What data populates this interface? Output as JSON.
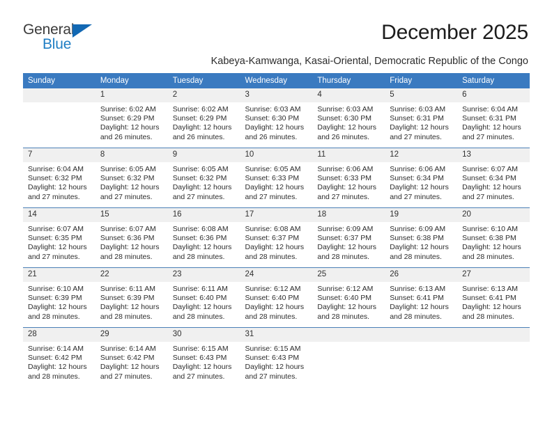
{
  "brand": {
    "name_top": "General",
    "name_bottom": "Blue",
    "triangle_color": "#1268b3",
    "blue_color": "#1f7ec4",
    "gray_color": "#3b3b3b"
  },
  "header": {
    "month_title": "December 2025",
    "location": "Kabeya-Kamwanga, Kasai-Oriental, Democratic Republic of the Congo"
  },
  "theme": {
    "header_blue": "#3a7ac0",
    "daynum_band": "#f0f0f0",
    "grid_line": "#4a7fb5",
    "text": "#2c2c2c"
  },
  "columns": [
    "Sunday",
    "Monday",
    "Tuesday",
    "Wednesday",
    "Thursday",
    "Friday",
    "Saturday"
  ],
  "weeks": [
    [
      {
        "day": "",
        "sunrise": "",
        "sunset": "",
        "daylight_line1": "",
        "daylight_line2": ""
      },
      {
        "day": "1",
        "sunrise": "Sunrise: 6:02 AM",
        "sunset": "Sunset: 6:29 PM",
        "daylight_line1": "Daylight: 12 hours",
        "daylight_line2": "and 26 minutes."
      },
      {
        "day": "2",
        "sunrise": "Sunrise: 6:02 AM",
        "sunset": "Sunset: 6:29 PM",
        "daylight_line1": "Daylight: 12 hours",
        "daylight_line2": "and 26 minutes."
      },
      {
        "day": "3",
        "sunrise": "Sunrise: 6:03 AM",
        "sunset": "Sunset: 6:30 PM",
        "daylight_line1": "Daylight: 12 hours",
        "daylight_line2": "and 26 minutes."
      },
      {
        "day": "4",
        "sunrise": "Sunrise: 6:03 AM",
        "sunset": "Sunset: 6:30 PM",
        "daylight_line1": "Daylight: 12 hours",
        "daylight_line2": "and 26 minutes."
      },
      {
        "day": "5",
        "sunrise": "Sunrise: 6:03 AM",
        "sunset": "Sunset: 6:31 PM",
        "daylight_line1": "Daylight: 12 hours",
        "daylight_line2": "and 27 minutes."
      },
      {
        "day": "6",
        "sunrise": "Sunrise: 6:04 AM",
        "sunset": "Sunset: 6:31 PM",
        "daylight_line1": "Daylight: 12 hours",
        "daylight_line2": "and 27 minutes."
      }
    ],
    [
      {
        "day": "7",
        "sunrise": "Sunrise: 6:04 AM",
        "sunset": "Sunset: 6:32 PM",
        "daylight_line1": "Daylight: 12 hours",
        "daylight_line2": "and 27 minutes."
      },
      {
        "day": "8",
        "sunrise": "Sunrise: 6:05 AM",
        "sunset": "Sunset: 6:32 PM",
        "daylight_line1": "Daylight: 12 hours",
        "daylight_line2": "and 27 minutes."
      },
      {
        "day": "9",
        "sunrise": "Sunrise: 6:05 AM",
        "sunset": "Sunset: 6:32 PM",
        "daylight_line1": "Daylight: 12 hours",
        "daylight_line2": "and 27 minutes."
      },
      {
        "day": "10",
        "sunrise": "Sunrise: 6:05 AM",
        "sunset": "Sunset: 6:33 PM",
        "daylight_line1": "Daylight: 12 hours",
        "daylight_line2": "and 27 minutes."
      },
      {
        "day": "11",
        "sunrise": "Sunrise: 6:06 AM",
        "sunset": "Sunset: 6:33 PM",
        "daylight_line1": "Daylight: 12 hours",
        "daylight_line2": "and 27 minutes."
      },
      {
        "day": "12",
        "sunrise": "Sunrise: 6:06 AM",
        "sunset": "Sunset: 6:34 PM",
        "daylight_line1": "Daylight: 12 hours",
        "daylight_line2": "and 27 minutes."
      },
      {
        "day": "13",
        "sunrise": "Sunrise: 6:07 AM",
        "sunset": "Sunset: 6:34 PM",
        "daylight_line1": "Daylight: 12 hours",
        "daylight_line2": "and 27 minutes."
      }
    ],
    [
      {
        "day": "14",
        "sunrise": "Sunrise: 6:07 AM",
        "sunset": "Sunset: 6:35 PM",
        "daylight_line1": "Daylight: 12 hours",
        "daylight_line2": "and 27 minutes."
      },
      {
        "day": "15",
        "sunrise": "Sunrise: 6:07 AM",
        "sunset": "Sunset: 6:36 PM",
        "daylight_line1": "Daylight: 12 hours",
        "daylight_line2": "and 28 minutes."
      },
      {
        "day": "16",
        "sunrise": "Sunrise: 6:08 AM",
        "sunset": "Sunset: 6:36 PM",
        "daylight_line1": "Daylight: 12 hours",
        "daylight_line2": "and 28 minutes."
      },
      {
        "day": "17",
        "sunrise": "Sunrise: 6:08 AM",
        "sunset": "Sunset: 6:37 PM",
        "daylight_line1": "Daylight: 12 hours",
        "daylight_line2": "and 28 minutes."
      },
      {
        "day": "18",
        "sunrise": "Sunrise: 6:09 AM",
        "sunset": "Sunset: 6:37 PM",
        "daylight_line1": "Daylight: 12 hours",
        "daylight_line2": "and 28 minutes."
      },
      {
        "day": "19",
        "sunrise": "Sunrise: 6:09 AM",
        "sunset": "Sunset: 6:38 PM",
        "daylight_line1": "Daylight: 12 hours",
        "daylight_line2": "and 28 minutes."
      },
      {
        "day": "20",
        "sunrise": "Sunrise: 6:10 AM",
        "sunset": "Sunset: 6:38 PM",
        "daylight_line1": "Daylight: 12 hours",
        "daylight_line2": "and 28 minutes."
      }
    ],
    [
      {
        "day": "21",
        "sunrise": "Sunrise: 6:10 AM",
        "sunset": "Sunset: 6:39 PM",
        "daylight_line1": "Daylight: 12 hours",
        "daylight_line2": "and 28 minutes."
      },
      {
        "day": "22",
        "sunrise": "Sunrise: 6:11 AM",
        "sunset": "Sunset: 6:39 PM",
        "daylight_line1": "Daylight: 12 hours",
        "daylight_line2": "and 28 minutes."
      },
      {
        "day": "23",
        "sunrise": "Sunrise: 6:11 AM",
        "sunset": "Sunset: 6:40 PM",
        "daylight_line1": "Daylight: 12 hours",
        "daylight_line2": "and 28 minutes."
      },
      {
        "day": "24",
        "sunrise": "Sunrise: 6:12 AM",
        "sunset": "Sunset: 6:40 PM",
        "daylight_line1": "Daylight: 12 hours",
        "daylight_line2": "and 28 minutes."
      },
      {
        "day": "25",
        "sunrise": "Sunrise: 6:12 AM",
        "sunset": "Sunset: 6:40 PM",
        "daylight_line1": "Daylight: 12 hours",
        "daylight_line2": "and 28 minutes."
      },
      {
        "day": "26",
        "sunrise": "Sunrise: 6:13 AM",
        "sunset": "Sunset: 6:41 PM",
        "daylight_line1": "Daylight: 12 hours",
        "daylight_line2": "and 28 minutes."
      },
      {
        "day": "27",
        "sunrise": "Sunrise: 6:13 AM",
        "sunset": "Sunset: 6:41 PM",
        "daylight_line1": "Daylight: 12 hours",
        "daylight_line2": "and 28 minutes."
      }
    ],
    [
      {
        "day": "28",
        "sunrise": "Sunrise: 6:14 AM",
        "sunset": "Sunset: 6:42 PM",
        "daylight_line1": "Daylight: 12 hours",
        "daylight_line2": "and 28 minutes."
      },
      {
        "day": "29",
        "sunrise": "Sunrise: 6:14 AM",
        "sunset": "Sunset: 6:42 PM",
        "daylight_line1": "Daylight: 12 hours",
        "daylight_line2": "and 27 minutes."
      },
      {
        "day": "30",
        "sunrise": "Sunrise: 6:15 AM",
        "sunset": "Sunset: 6:43 PM",
        "daylight_line1": "Daylight: 12 hours",
        "daylight_line2": "and 27 minutes."
      },
      {
        "day": "31",
        "sunrise": "Sunrise: 6:15 AM",
        "sunset": "Sunset: 6:43 PM",
        "daylight_line1": "Daylight: 12 hours",
        "daylight_line2": "and 27 minutes."
      },
      {
        "day": "",
        "sunrise": "",
        "sunset": "",
        "daylight_line1": "",
        "daylight_line2": ""
      },
      {
        "day": "",
        "sunrise": "",
        "sunset": "",
        "daylight_line1": "",
        "daylight_line2": ""
      },
      {
        "day": "",
        "sunrise": "",
        "sunset": "",
        "daylight_line1": "",
        "daylight_line2": ""
      }
    ]
  ]
}
